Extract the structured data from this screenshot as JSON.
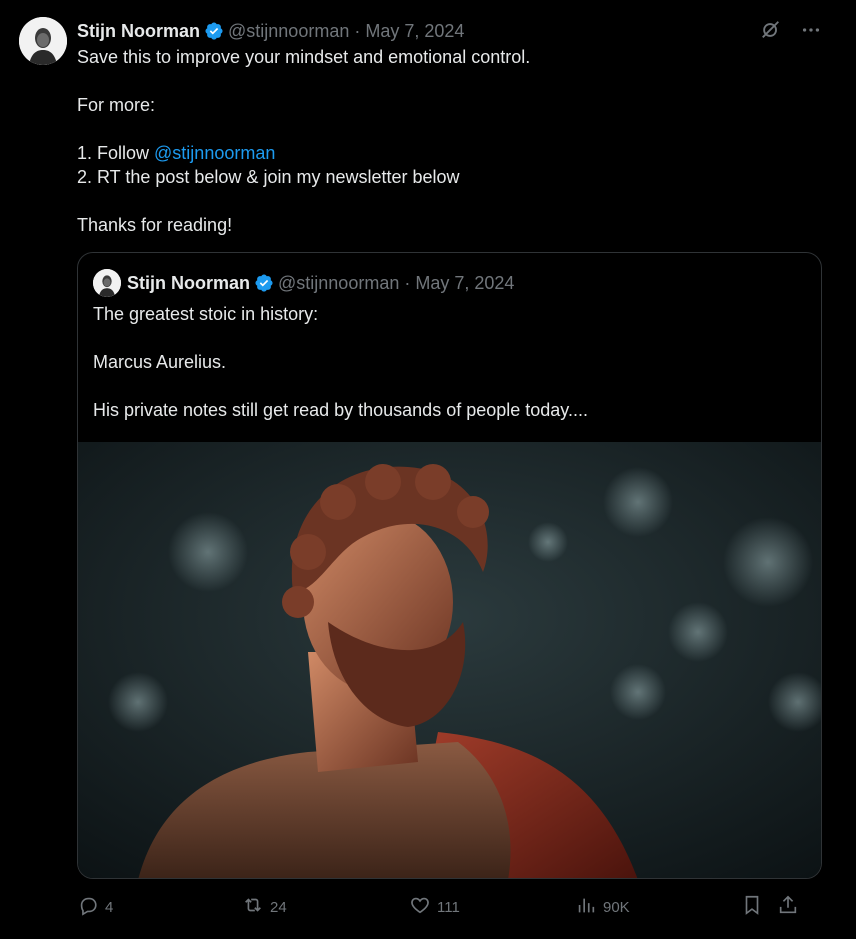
{
  "author": {
    "name": "Stijn Noorman",
    "handle": "@stijnnoorman",
    "separator": "·",
    "date": "May 7, 2024"
  },
  "post": {
    "line1": "Save this to improve your mindset and emotional control.",
    "line2": "For more:",
    "line3_prefix": "1. Follow ",
    "line3_link": "@stijnnoorman",
    "line4": "2. RT the post below & join my newsletter below",
    "line5": "Thanks for reading!"
  },
  "quoted": {
    "name": "Stijn Noorman",
    "handle": "@stijnnoorman",
    "separator": "·",
    "date": "May 7, 2024",
    "line1": "The greatest stoic in history:",
    "line2": "Marcus Aurelius.",
    "line3": "His private notes still get read by thousands of people today...."
  },
  "actions": {
    "replies": "4",
    "reposts": "24",
    "likes": "111",
    "views": "90K"
  },
  "icons": {
    "verified": "verified-badge-icon",
    "grok": "grok-icon",
    "more": "more-icon",
    "reply": "reply-icon",
    "repost": "repost-icon",
    "like": "heart-icon",
    "views": "views-icon",
    "bookmark": "bookmark-icon",
    "share": "share-icon"
  },
  "colors": {
    "background": "#000000",
    "text": "#e7e9ea",
    "muted": "#71767b",
    "link": "#1d9bf0",
    "border": "#2f3336"
  }
}
